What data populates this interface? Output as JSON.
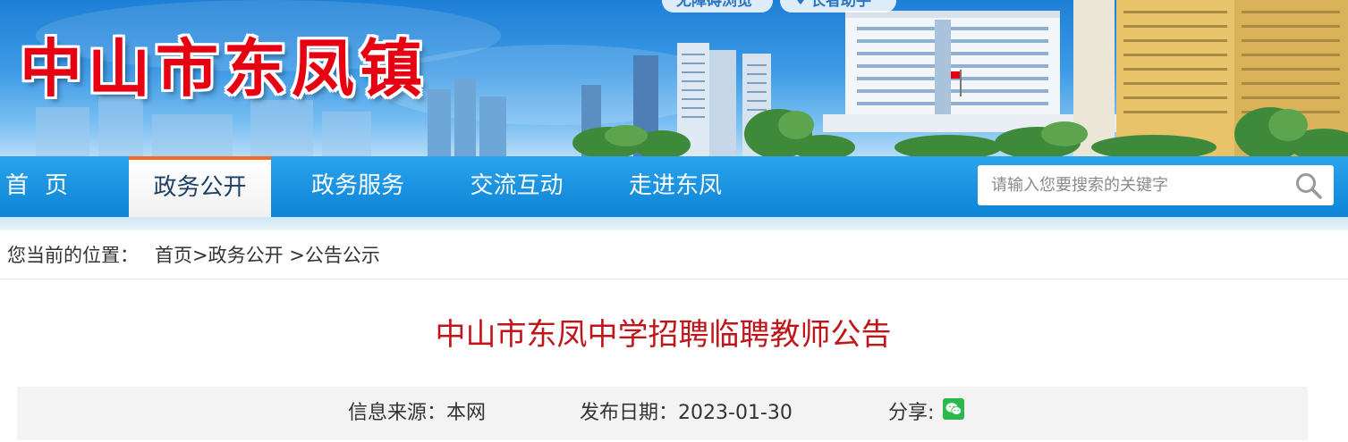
{
  "banner": {
    "site_title": "中山市东凤镇",
    "pill_accessibility": "无障碍浏览",
    "pill_elder": "长者助手"
  },
  "nav": {
    "home": "首页",
    "government_open": "政务公开",
    "government_service": "政务服务",
    "interaction": "交流互动",
    "about": "走进东凤",
    "active": "政务公开"
  },
  "search": {
    "placeholder": "请输入您要搜索的关键字"
  },
  "breadcrumb": {
    "prefix": "您当前的位置：",
    "home": "首页",
    "sep1": ">",
    "section": "政务公开",
    "sep2": " >",
    "current": "公告公示"
  },
  "article": {
    "title": "中山市东凤中学招聘临聘教师公告",
    "source_label": "信息来源：",
    "source_value": "本网",
    "date_label": "发布日期：",
    "date_value": "2023-01-30",
    "share_label": "分享:"
  },
  "colors": {
    "title_red": "#c0161b",
    "banner_red": "#e60012",
    "nav_blue": "#0d84d6",
    "active_tab_border": "#f36b21",
    "wechat_green": "#2db84d"
  },
  "icons": {
    "search": "search-icon",
    "share_wechat": "wechat-icon",
    "location": "location-pin-icon"
  }
}
